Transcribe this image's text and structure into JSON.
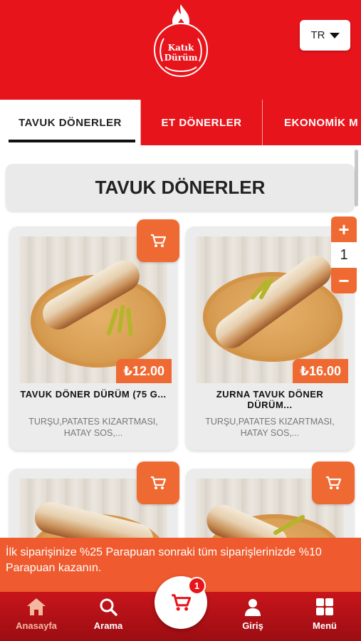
{
  "header": {
    "logo_line1": "Katık",
    "logo_line2": "Dürüm",
    "language": "TR"
  },
  "tabs": [
    {
      "label": "TAVUK DÖNERLER",
      "active": true
    },
    {
      "label": "ET DÖNERLER",
      "active": false
    },
    {
      "label": "EKONOMİK M",
      "active": false
    }
  ],
  "section": {
    "title": "TAVUK DÖNERLER"
  },
  "products": [
    {
      "name": "TAVUK DÖNER DÜRÜM (75 G...",
      "description": "TURŞU,PATATES KIZARTMASI, HATAY SOS,...",
      "price": "₺12.00"
    },
    {
      "name": "ZURNA TAVUK DÖNER DÜRÜM...",
      "description": "TURŞU,PATATES KIZARTMASI, HATAY SOS,...",
      "price": "₺16.00",
      "quantity": "1"
    },
    {
      "name": "",
      "description": "",
      "price": ""
    },
    {
      "name": "",
      "description": "",
      "price": ""
    }
  ],
  "stepper": {
    "plus": "+",
    "minus": "−",
    "quantity": "1"
  },
  "promo": {
    "text": "İlk siparişinize %25 Parapuan sonraki tüm siparişlerinizde %10 Parapuan kazanın."
  },
  "bottom_nav": {
    "home": "Anasayfa",
    "search": "Arama",
    "login": "Giriş",
    "menu": "Menü",
    "cart_count": "1"
  },
  "colors": {
    "brand_red": "#e8141b",
    "accent_orange": "#ef6a33",
    "promo_orange": "#ef5b2e",
    "active_nav": "#f3b8a0"
  },
  "icons": [
    "flame-logo-icon",
    "caret-down-icon",
    "cart-icon",
    "home-icon",
    "search-icon",
    "user-icon",
    "grid-icon"
  ]
}
